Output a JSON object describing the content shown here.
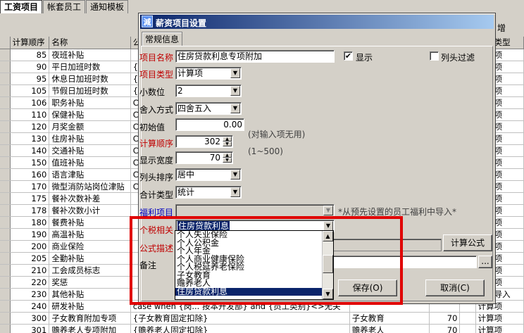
{
  "tabs": [
    "工资项目",
    "帐套员工",
    "通知模板"
  ],
  "right_toolbar": {
    "label": "增"
  },
  "grid": {
    "headers": [
      "计算顺序",
      "名称",
      "公",
      "",
      "",
      "",
      "计算类型"
    ],
    "rows": [
      {
        "order": "85",
        "name": "夜班补贴",
        "formula": "",
        "cat": "",
        "w": "",
        "type": "计算项"
      },
      {
        "order": "90",
        "name": "平日加班时数",
        "formula": "{",
        "cat": "",
        "w": "",
        "type": "计算项"
      },
      {
        "order": "95",
        "name": "休息日加班时数",
        "formula": "{",
        "cat": "",
        "w": "",
        "type": "计算项"
      },
      {
        "order": "105",
        "name": "节假日加班时数",
        "formula": "{",
        "cat": "",
        "w": "",
        "type": "计算项"
      },
      {
        "order": "106",
        "name": "职务补贴",
        "formula": "C",
        "cat": "",
        "w": "",
        "type": "计算项"
      },
      {
        "order": "110",
        "name": "保健补贴",
        "formula": "C",
        "cat": "",
        "w": "",
        "type": "计算项"
      },
      {
        "order": "120",
        "name": "月奖金额",
        "formula": "C",
        "cat": "",
        "w": "",
        "type": "计算项"
      },
      {
        "order": "130",
        "name": "住房补贴",
        "formula": "C",
        "cat": "",
        "w": "",
        "type": "计算项"
      },
      {
        "order": "140",
        "name": "交通补贴",
        "formula": "C",
        "cat": "",
        "w": "",
        "type": "计算项"
      },
      {
        "order": "150",
        "name": "值班补贴",
        "formula": "C",
        "cat": "",
        "w": "",
        "type": "计算项"
      },
      {
        "order": "160",
        "name": "语言津贴",
        "formula": "C",
        "cat": "",
        "w": "",
        "type": "计算项"
      },
      {
        "order": "170",
        "name": "微型消防站岗位津贴",
        "formula": "C",
        "cat": "",
        "w": "",
        "type": "计算项"
      },
      {
        "order": "175",
        "name": "餐补次数补差",
        "formula": "",
        "cat": "",
        "w": "",
        "type": "计算项"
      },
      {
        "order": "178",
        "name": "餐补次数小计",
        "formula": "",
        "cat": "",
        "w": "",
        "type": "计算项"
      },
      {
        "order": "180",
        "name": "餐费补贴",
        "formula": "",
        "cat": "",
        "w": "",
        "type": "计算项"
      },
      {
        "order": "190",
        "name": "高温补贴",
        "formula": "",
        "cat": "",
        "w": "",
        "type": "计算项"
      },
      {
        "order": "200",
        "name": "商业保险",
        "formula": "",
        "cat": "",
        "w": "",
        "type": "计算项"
      },
      {
        "order": "205",
        "name": "全勤补贴",
        "formula": "",
        "cat": "",
        "w": "",
        "type": "计算项"
      },
      {
        "order": "210",
        "name": "工会成员标志",
        "formula": "",
        "cat": "",
        "w": "",
        "type": "计算项"
      },
      {
        "order": "220",
        "name": "奖惩",
        "formula": "",
        "cat": "",
        "w": "",
        "type": "计算项"
      },
      {
        "order": "230",
        "name": "其他补贴",
        "formula": "",
        "cat": "",
        "w": "",
        "type": "福利导入"
      },
      {
        "order": "240",
        "name": "研发补贴",
        "formula": "case when {岗... 按本开发部} and {员工类别}<>无关",
        "cat": "",
        "w": "",
        "type": "计算项"
      },
      {
        "order": "300",
        "name": "子女教育附加专项",
        "formula": "{子女教育固定扣除}",
        "cat": "子女教育",
        "w": "70",
        "type": "计算项"
      },
      {
        "order": "301",
        "name": "赡养老人专项附加",
        "formula": "{赡养老人固定扣除}",
        "cat": "赡养老人",
        "w": "70",
        "type": "计算项"
      }
    ]
  },
  "dialog": {
    "title": "薪资项目设置",
    "tab": "常规信息",
    "labels": {
      "name": "项目名称",
      "type": "项目类型",
      "decimals": "小数位",
      "rounding": "舍入方式",
      "initial": "初始值",
      "order": "计算顺序",
      "width": "显示宽度",
      "col_sort": "列头排序",
      "sum_type": "合计类型",
      "welfare": "福利项目",
      "tax": "个税相关",
      "formula_desc": "公式描述",
      "remark": "备注"
    },
    "values": {
      "name": "住房贷款利息专项附加",
      "type": "计算项",
      "decimals": "2",
      "rounding": "四舍五入",
      "initial": "0.00",
      "order": "302",
      "width": "70",
      "col_sort": "居中",
      "sum_type": "统计",
      "welfare": "",
      "tax": "住房贷款利息",
      "remark": ""
    },
    "show_checkbox": {
      "label": "显示",
      "checked": true,
      "mark": "✔"
    },
    "filter_checkbox": {
      "label": "列头过滤",
      "checked": false
    },
    "hints": {
      "initial": "(对输入项无用)",
      "order_range": "(1~500)",
      "welfare": "*从预先设置的员工福利中导入*"
    },
    "buttons": {
      "calc_formula": "计算公式",
      "save": "保存(O)",
      "cancel": "取消(C)",
      "ellipsis": "..."
    },
    "tax_options": [
      "个人失业保险",
      "个人公积金",
      "个人年金",
      "个人商业健康保险",
      "个人税延养老保险",
      "子女教育",
      "赡养老人",
      "住房贷款利息"
    ],
    "tax_selected_index": 7
  }
}
